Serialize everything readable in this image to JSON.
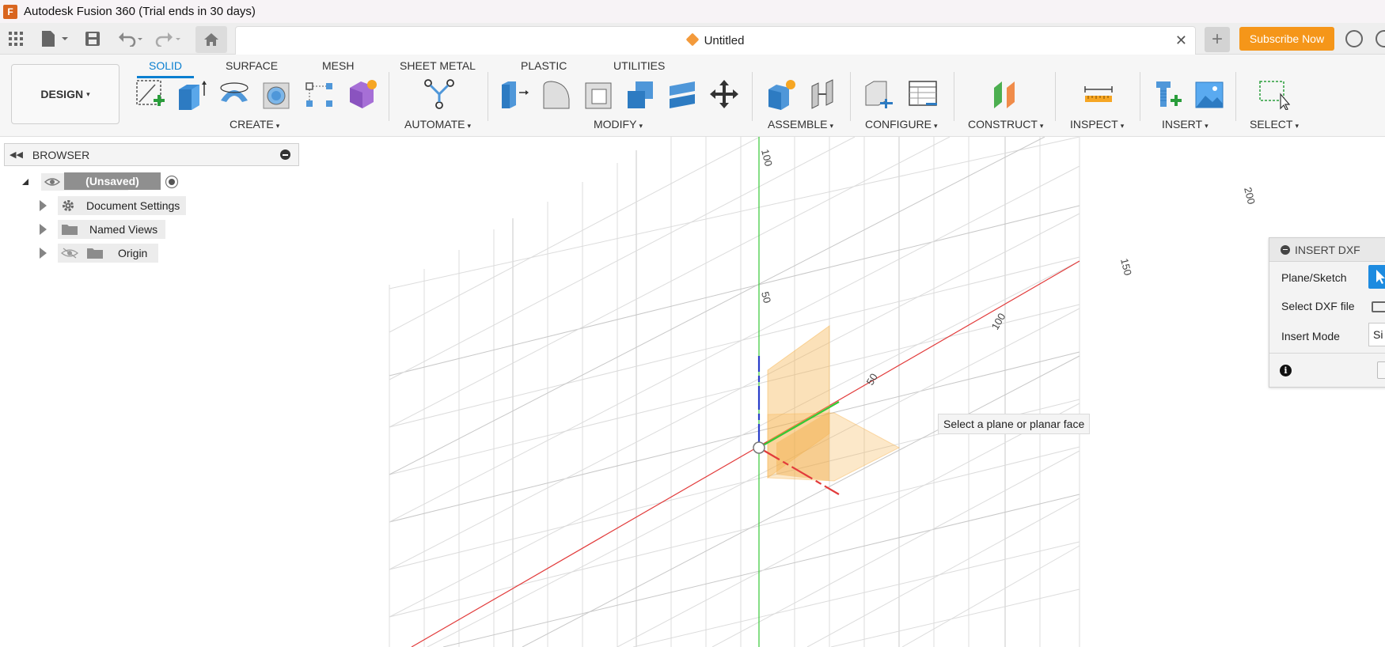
{
  "titlebar": {
    "app_icon_letter": "F",
    "title": "Autodesk Fusion 360 (Trial ends in 30 days)"
  },
  "tabbar": {
    "document_title": "Untitled",
    "close_glyph": "✕",
    "new_tab_glyph": "+",
    "subscribe_label": "Subscribe Now"
  },
  "workspace": {
    "label": "DESIGN",
    "caret": "▾"
  },
  "ribbon_tabs": [
    "SOLID",
    "SURFACE",
    "MESH",
    "SHEET METAL",
    "PLASTIC",
    "UTILITIES"
  ],
  "active_tab": "SOLID",
  "groups": {
    "create": "CREATE",
    "automate": "AUTOMATE",
    "modify": "MODIFY",
    "assemble": "ASSEMBLE",
    "configure": "CONFIGURE",
    "construct": "CONSTRUCT",
    "inspect": "INSPECT",
    "insert": "INSERT",
    "select": "SELECT"
  },
  "browser": {
    "title": "BROWSER",
    "root_label": "(Unsaved)",
    "items": [
      {
        "label": "Document Settings",
        "icon": "gear-icon"
      },
      {
        "label": "Named Views",
        "icon": "folder-icon"
      },
      {
        "label": "Origin",
        "icon": "folder-icon"
      }
    ]
  },
  "viewport": {
    "axis_labels": {
      "y_100": "100",
      "y_50": "50",
      "x_50": "50",
      "x_100": "100",
      "x_150": "150",
      "x_200": "200"
    },
    "tooltip": "Select a plane or planar face",
    "colors": {
      "x_axis": "#e23b3b",
      "y_axis": "#35c935",
      "z_axis": "#2a3fc9",
      "plane": "#f7b24a",
      "grid": "#d8d8d8"
    }
  },
  "insert_dxf": {
    "title": "INSERT DXF",
    "plane_sketch_label": "Plane/Sketch",
    "select_file_label": "Select DXF file",
    "insert_mode_label": "Insert Mode",
    "insert_mode_value": "Si",
    "info_glyph": "i"
  }
}
